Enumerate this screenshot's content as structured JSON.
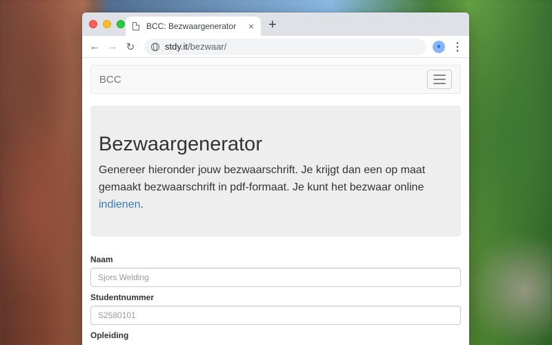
{
  "browser": {
    "tab_title": "BCC: Bezwaargenerator",
    "tab_close": "×",
    "new_tab": "+",
    "url_host": "stdy.it",
    "url_path": "/bezwaar/",
    "back": "←",
    "forward": "→",
    "reload": "↻",
    "menu": "⋮"
  },
  "navbar": {
    "brand": "BCC"
  },
  "jumbotron": {
    "title": "Bezwaargenerator",
    "text": "Genereer hieronder jouw bezwaarschrift. Je krijgt dan een op maat gemaakt bezwaarschrift in pdf-formaat. Je kunt het bezwaar online ",
    "link": "indienen",
    "end": "."
  },
  "form": {
    "fields": [
      {
        "label": "Naam",
        "placeholder": "Sjors Welding"
      },
      {
        "label": "Studentnummer",
        "placeholder": "S2580101"
      },
      {
        "label": "Opleiding",
        "placeholder": ""
      }
    ]
  }
}
